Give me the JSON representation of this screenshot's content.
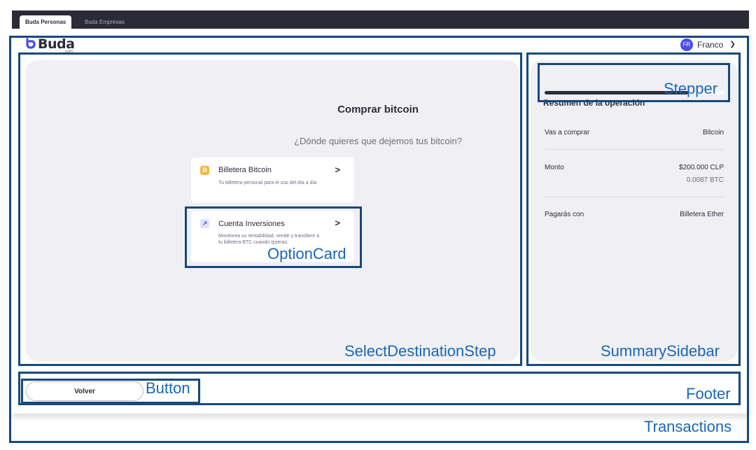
{
  "browser": {
    "tabs": [
      {
        "label": "Buda Personas",
        "active": true
      },
      {
        "label": "Buda Empresas",
        "active": false
      }
    ]
  },
  "header": {
    "logo_text": "Buda",
    "logo_sub": ".com",
    "user": {
      "initials": "FR",
      "name": "Franco"
    }
  },
  "main": {
    "title": "Comprar bitcoin",
    "question": "¿Dónde quieres que dejemos tus bitcoin?",
    "options": [
      {
        "title": "Billetera Bitcoin",
        "description": "Tu billetera personal para el uso del día a día",
        "icon": "bitcoin-wallet-icon"
      },
      {
        "title": "Cuenta Inversiones",
        "description": "Monitorea su rentabilidad, vende y transfiere a tu billetera BTC cuando quieras.",
        "icon": "investment-icon"
      }
    ]
  },
  "summary": {
    "progress": 0.8,
    "title": "Resumen de la operación",
    "rows": [
      {
        "label": "Vas a comprar",
        "value": "Bitcoin"
      },
      {
        "label": "Monto",
        "value": "$200.000 CLP",
        "sub": "0.0087 BTC"
      },
      {
        "label": "Pagarás con",
        "value": "Billetera Ether"
      }
    ]
  },
  "footer": {
    "back_label": "Volver"
  },
  "annotations": {
    "stepper": "Stepper",
    "option_card": "OptionCard",
    "select_destination": "SelectDestinationStep",
    "summary_sidebar": "SummarySidebar",
    "button": "Button",
    "footer": "Footer",
    "transactions": "Transactions"
  },
  "colors": {
    "brand": "#4a4cf0",
    "annotation_border": "#14497e",
    "annotation_text": "#1a66b8",
    "bitcoin": "#f5b840"
  }
}
